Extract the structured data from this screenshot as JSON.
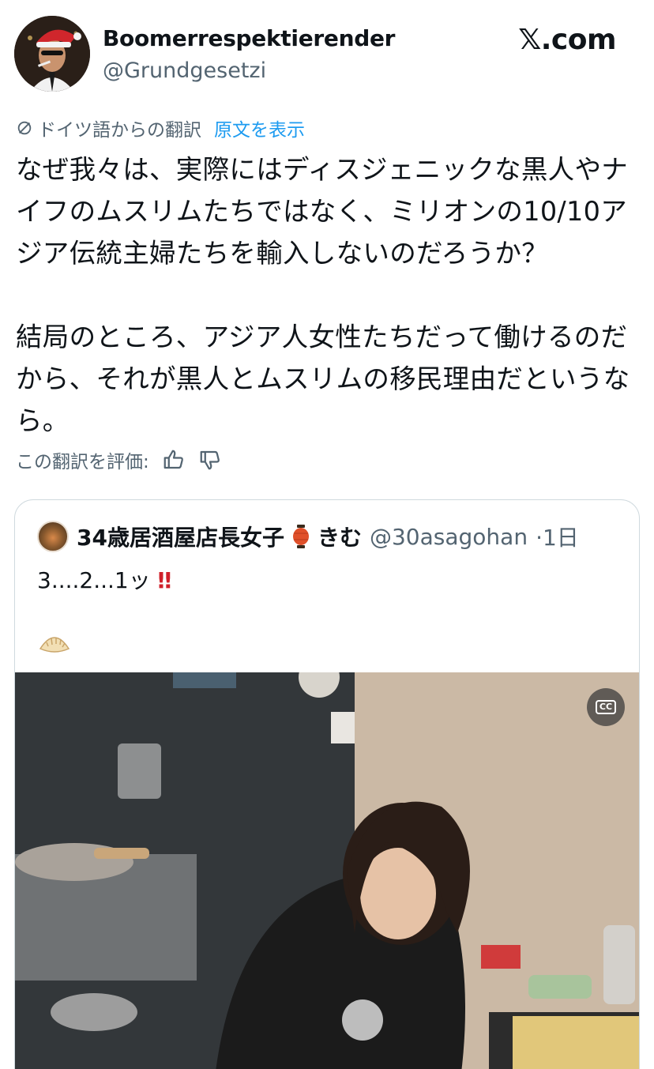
{
  "header": {
    "display_name": "Boomerrespektierender",
    "handle": "@Grundgesetzi",
    "brand": "𝕏.com"
  },
  "translation": {
    "label": "ドイツ語からの翻訳",
    "show_original": "原文を表示",
    "rate_label": "この翻訳を評価:"
  },
  "tweet": {
    "body": "なぜ我々は、実際にはディスジェニックな黒人やナイフのムスリムたちではなく、ミリオンの10/10アジア伝統主婦たちを輸入しないのだろうか？\n\n結局のところ、アジア人女性たちだって働けるのだから、それが黒人とムスリムの移民理由だというなら。"
  },
  "quote": {
    "name": "34歳居酒屋店長女子",
    "name_suffix": "きむ",
    "handle": "@30asagohan",
    "time": "·1日",
    "text": "3....2...1ッ",
    "bang": "‼"
  },
  "icons": {
    "translate": "translate-off-icon",
    "thumbs_up": "thumbs-up-icon",
    "thumbs_down": "thumbs-down-icon",
    "lantern": "lantern-icon",
    "gyoza": "gyoza-icon",
    "cc": "closed-captions-icon"
  },
  "colors": {
    "link": "#1d9bf0",
    "secondary_text": "#536471",
    "border": "#cfd9de"
  }
}
